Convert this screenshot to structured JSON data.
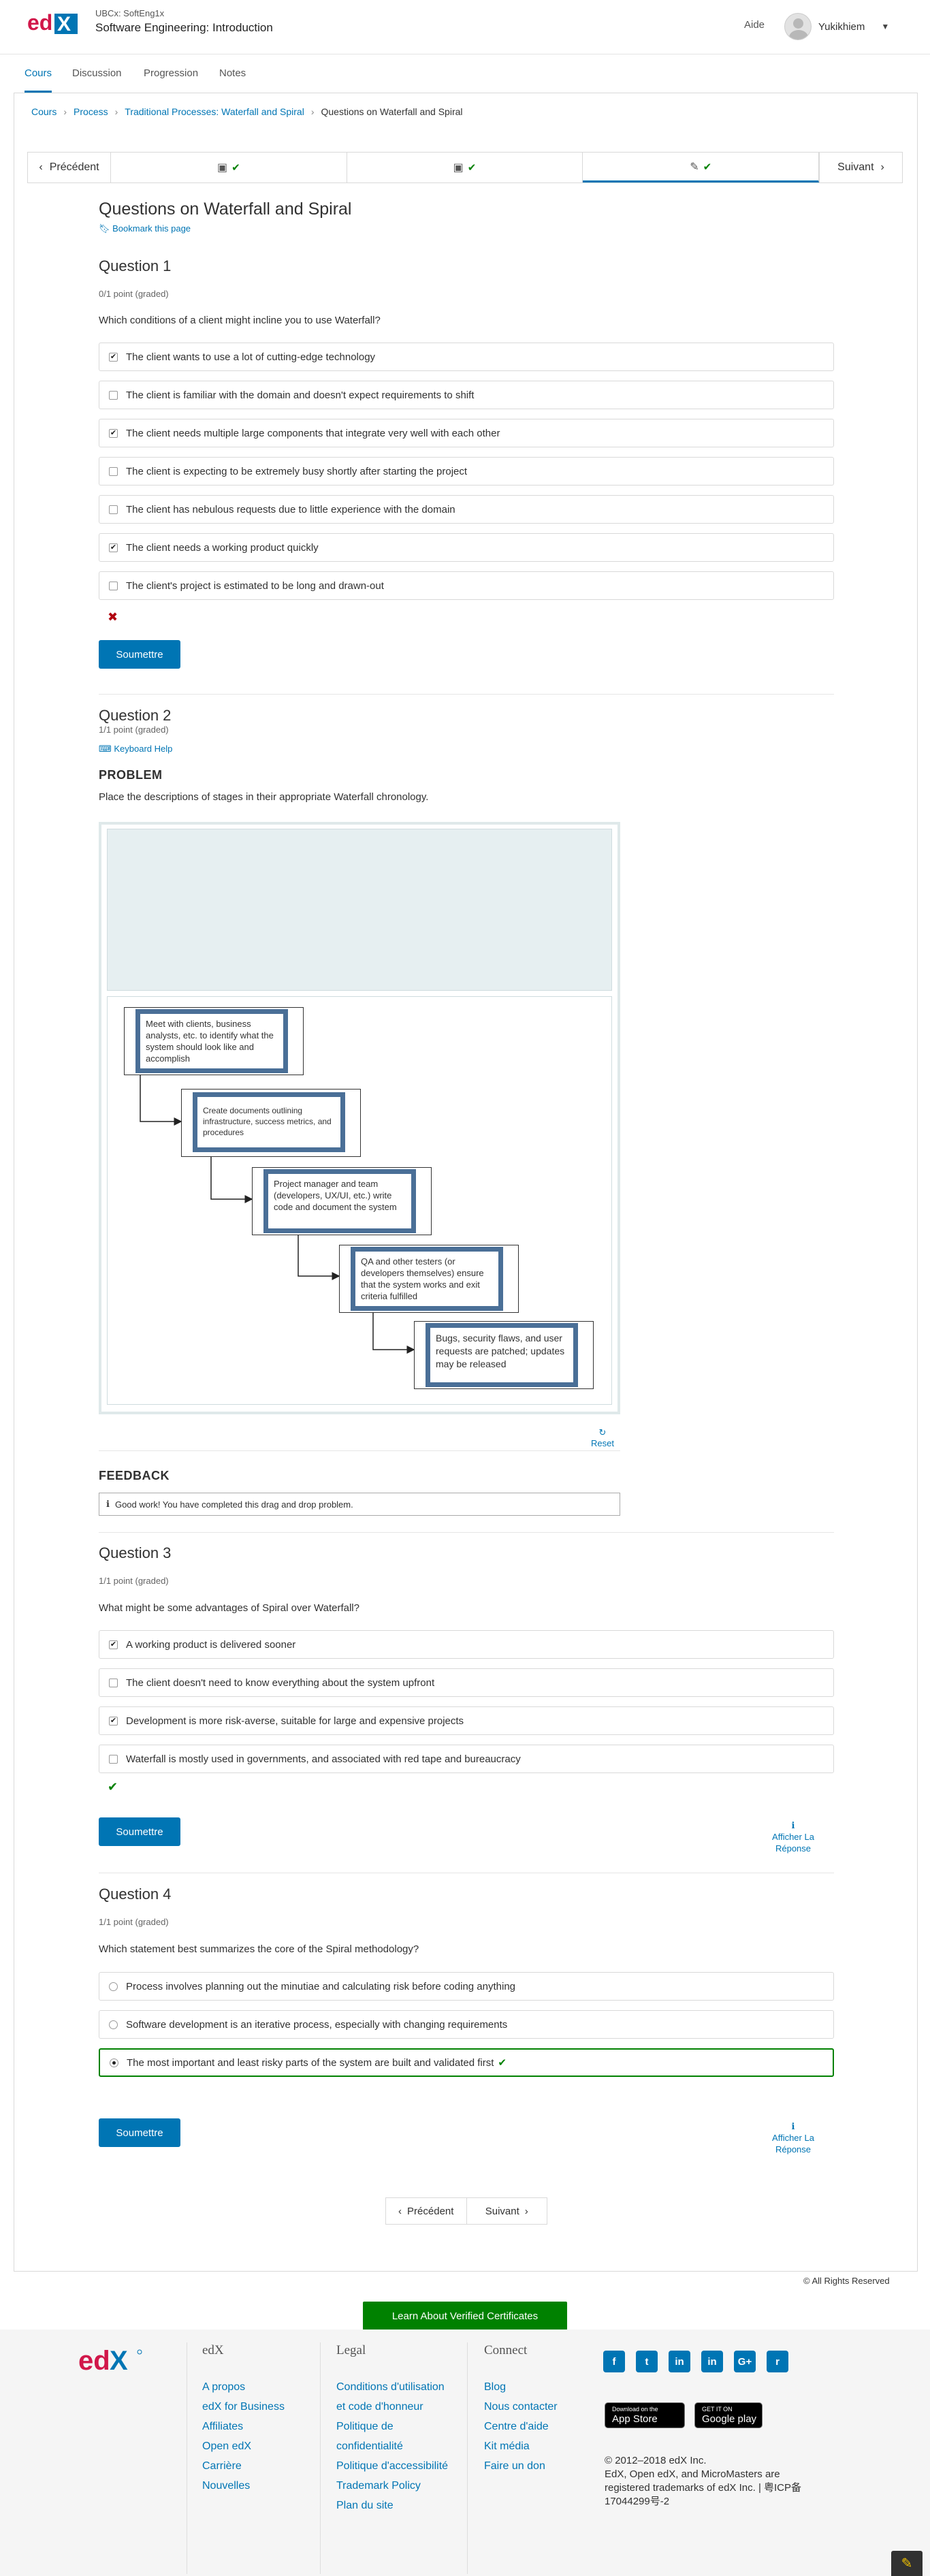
{
  "header": {
    "logo": "edX",
    "course_org": "UBCx: SoftEng1x",
    "course_name": "Software Engineering: Introduction",
    "help": "Aide",
    "username": "Yukikhiem"
  },
  "tabs": [
    "Cours",
    "Discussion",
    "Progression",
    "Notes"
  ],
  "breadcrumbs": [
    "Cours",
    "Process",
    "Traditional Processes: Waterfall and Spiral",
    "Questions on Waterfall and Spiral"
  ],
  "sequence": {
    "prev": "Précédent",
    "next": "Suivant",
    "items": [
      "video-icon",
      "video-icon",
      "problem-icon"
    ]
  },
  "unit": {
    "title": "Questions on Waterfall and Spiral",
    "bookmark": "Bookmark this page"
  },
  "q1": {
    "title": "Question 1",
    "points": "0/1 point (graded)",
    "text": "Which conditions of a client might incline you to use Waterfall?",
    "options": [
      {
        "label": "The client wants to use a lot of cutting-edge technology",
        "checked": true
      },
      {
        "label": "The client is familiar with the domain and doesn't expect requirements to shift",
        "checked": false
      },
      {
        "label": "The client needs multiple large components that integrate very well with each other",
        "checked": true
      },
      {
        "label": "The client is expecting to be extremely busy shortly after starting the project",
        "checked": false
      },
      {
        "label": "The client has nebulous requests due to little experience with the domain",
        "checked": false
      },
      {
        "label": "The client needs a working product quickly",
        "checked": true
      },
      {
        "label": "The client's project is estimated to be long and drawn-out",
        "checked": false
      }
    ],
    "status": "incorrect",
    "submit": "Soumettre"
  },
  "q2": {
    "title": "Question 2",
    "points": "1/1 point (graded)",
    "keyboard_help": "Keyboard Help",
    "problem_heading": "PROBLEM",
    "text": "Place the descriptions of stages in their appropriate Waterfall chronology.",
    "stages": [
      "Meet with clients, business analysts, etc. to identify what the system should look like and accomplish",
      "Create documents outlining infrastructure, success metrics, and procedures",
      "Project manager and team (developers, UX/UI, etc.) write code and document the system",
      "QA and other testers (or developers themselves) ensure that the system works and exit criteria fulfilled",
      "Bugs, security flaws, and user requests are patched; updates may be released"
    ],
    "reset": "Reset",
    "feedback_heading": "FEEDBACK",
    "feedback": "Good work! You have completed this drag and drop problem."
  },
  "q3": {
    "title": "Question 3",
    "points": "1/1 point (graded)",
    "text": "What might be some advantages of Spiral over Waterfall?",
    "options": [
      {
        "label": "A working product is delivered sooner",
        "checked": true
      },
      {
        "label": "The client doesn't need to know everything about the system upfront",
        "checked": false
      },
      {
        "label": "Development is more risk-averse, suitable for large and expensive projects",
        "checked": true
      },
      {
        "label": "Waterfall is mostly used in governments, and associated with red tape and bureaucracy",
        "checked": false
      }
    ],
    "status": "correct",
    "submit": "Soumettre",
    "show_answer": "Afficher La Réponse"
  },
  "q4": {
    "title": "Question 4",
    "points": "1/1 point (graded)",
    "text": "Which statement best summarizes the core of the Spiral methodology?",
    "options": [
      {
        "label": "Process involves planning out the minutiae and calculating risk before coding anything",
        "checked": false
      },
      {
        "label": "Software development is an iterative process, especially with changing requirements",
        "checked": false
      },
      {
        "label": "The most important and least risky parts of the system are built and validated first",
        "checked": true
      }
    ],
    "submit": "Soumettre",
    "show_answer": "Afficher La Réponse"
  },
  "pager": {
    "prev": "Précédent",
    "next": "Suivant"
  },
  "verified_cta": "Learn About Verified Certificates",
  "rights": "© All Rights Reserved",
  "footer": {
    "col1": {
      "title": "edX",
      "links": [
        "A propos",
        "edX for Business",
        "Affiliates",
        "Open edX",
        "Carrière",
        "Nouvelles"
      ]
    },
    "col2": {
      "title": "Legal",
      "links": [
        "Conditions d'utilisation et code d'honneur",
        "Politique de confidentialité",
        "Politique d'accessibilité",
        "Trademark Policy",
        "Plan du site"
      ]
    },
    "col3": {
      "title": "Connect",
      "links": [
        "Blog",
        "Nous contacter",
        "Centre d'aide",
        "Kit média",
        "Faire un don"
      ]
    },
    "social": [
      "facebook-icon",
      "twitter-icon",
      "linkedin-icon",
      "linkedin-icon",
      "google-plus-icon",
      "reddit-icon"
    ],
    "app_store": {
      "small": "Download on the",
      "big": "App Store"
    },
    "google_play": {
      "small": "GET IT ON",
      "big": "Google play"
    },
    "legal": "© 2012–2018 edX Inc.\nEdX, Open edX, and MicroMasters are registered trademarks of edX Inc. | 粤ICP备17044299号-2"
  },
  "colors": {
    "brand": "#0075b4",
    "correct": "#008100",
    "incorrect": "#b20610"
  }
}
